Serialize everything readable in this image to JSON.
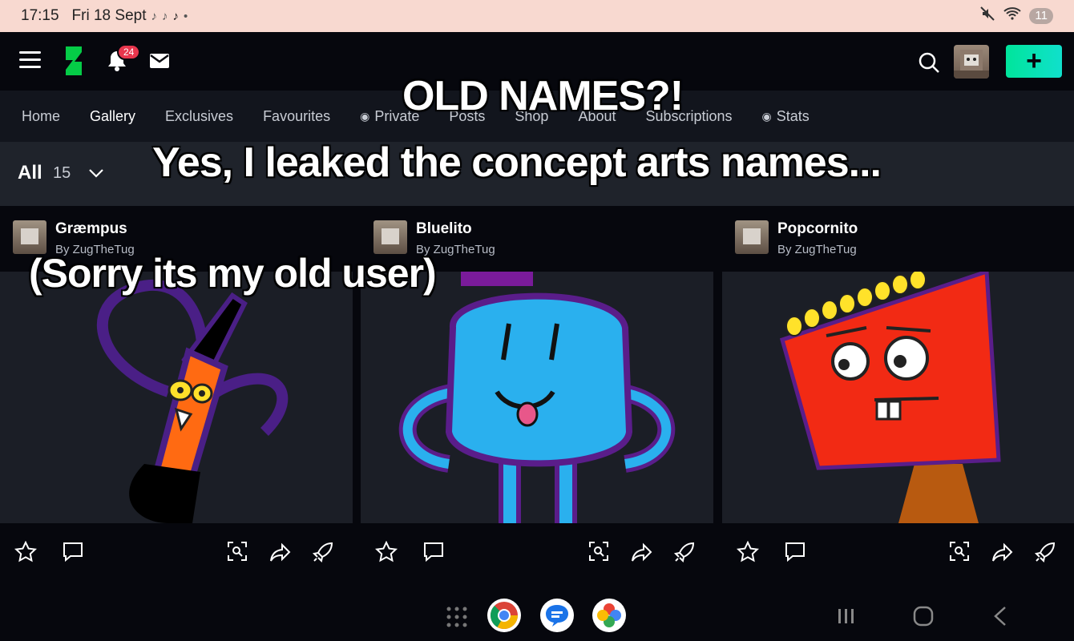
{
  "status_bar": {
    "time": "17:15",
    "date": "Fri 18 Sept",
    "battery": "11",
    "icons": [
      "tiktok-icon",
      "mute-icon",
      "wifi-icon"
    ]
  },
  "top_nav": {
    "notification_count": "24",
    "create_label": "+"
  },
  "tabs": [
    {
      "label": "Home"
    },
    {
      "label": "Gallery"
    },
    {
      "label": "Exclusives"
    },
    {
      "label": "Favourites"
    },
    {
      "label": "Private"
    },
    {
      "label": "Posts"
    },
    {
      "label": "Shop"
    },
    {
      "label": "About"
    },
    {
      "label": "Subscriptions"
    },
    {
      "label": "Stats"
    }
  ],
  "filter": {
    "label": "All",
    "count": "15"
  },
  "cards": [
    {
      "title": "Græmpus",
      "by": "By ZugTheTug"
    },
    {
      "title": "Bluelito",
      "by": "By ZugTheTug"
    },
    {
      "title": "Popcornito",
      "by": "By ZugTheTug"
    }
  ],
  "overlay": {
    "line1": "OLD NAMES?!",
    "line2": "Yes, I leaked the concept arts names...",
    "line3": "(Sorry its my old user)"
  },
  "colors": {
    "accent": "#00e59b",
    "badge": "#e8364d",
    "status_bar": "#f8d9d0"
  }
}
